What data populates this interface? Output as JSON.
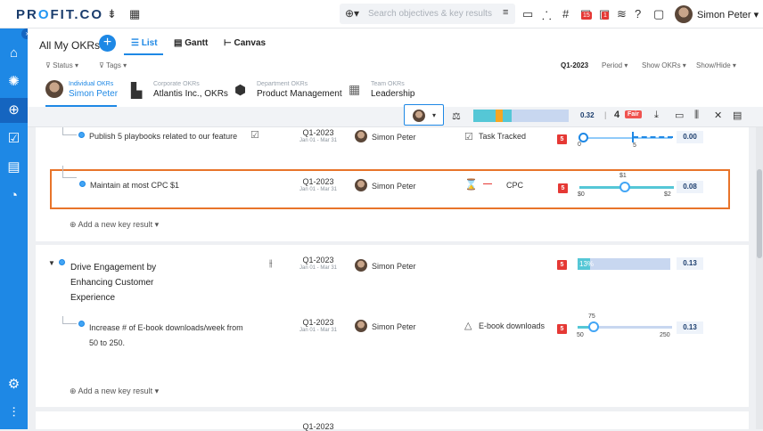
{
  "brand": {
    "logo_pre": "PR",
    "logo_o": "O",
    "logo_post": "FIT.CO"
  },
  "topbar": {
    "search_placeholder": "Search objectives & key results",
    "notification_badge_1": "15",
    "notification_badge_2": "1",
    "user_name": "Simon Peter",
    "user_caret": "▾"
  },
  "header": {
    "title": "All My OKRs",
    "add_label": "+",
    "views": [
      "List",
      "Gantt",
      "Canvas"
    ],
    "filters": {
      "status": "Status",
      "tags": "Tags"
    },
    "quarter": "Q1-2023",
    "controls": [
      "Period",
      "Show OKRs",
      "Show/Hide"
    ],
    "okr_tabs": [
      {
        "caption": "Individual OKRs",
        "name": "Simon Peter"
      },
      {
        "caption": "Corporate OKRs",
        "name": "Atlantis Inc., OKRs"
      },
      {
        "caption": "Department OKRs",
        "name": "Product Management"
      },
      {
        "caption": "Team OKRs",
        "name": "Leadership"
      }
    ]
  },
  "toolbar": {
    "progress_value": "0.32",
    "count": "4",
    "rating": "Fair",
    "separator": "|"
  },
  "rows": {
    "kr1": {
      "title": "Publish 5 playbooks related to our feature",
      "period": "Q1-2023",
      "dates": "Jan 01 - Mar 31",
      "owner": "Simon Peter",
      "metric": "Task Tracked",
      "confidence": "5",
      "min": "0",
      "target": "5",
      "score": "0.00"
    },
    "kr2": {
      "title": "Maintain at most CPC $1",
      "period": "Q1-2023",
      "dates": "Jan 01 - Mar 31",
      "owner": "Simon Peter",
      "metric": "CPC",
      "confidence": "5",
      "min": "$0",
      "current": "$1",
      "max": "$2",
      "score": "0.08"
    },
    "add_kr_label": "Add a new key result",
    "objective": {
      "title_line1": "Drive Engagement by",
      "title_line2": "Enhancing Customer",
      "title_line3": "Experience",
      "period": "Q1-2023",
      "dates": "Jan 01 - Mar 31",
      "owner": "Simon Peter",
      "confidence": "5",
      "progress_label": "13%",
      "progress": 0.13,
      "score": "0.13"
    },
    "kr3": {
      "title_line1": "Increase # of E-book downloads/week from",
      "title_line2": "50 to 250.",
      "period": "Q1-2023",
      "dates": "Jan 01 - Mar 31",
      "owner": "Simon Peter",
      "metric": "E-book downloads",
      "confidence": "5",
      "min": "50",
      "current": "75",
      "max": "250",
      "score": "0.13"
    },
    "next_period": "Q1-2023"
  },
  "colors": {
    "accent": "#1e88e5",
    "danger": "#e53935",
    "highlight": "#e8742a",
    "fair": "#ef5350"
  }
}
